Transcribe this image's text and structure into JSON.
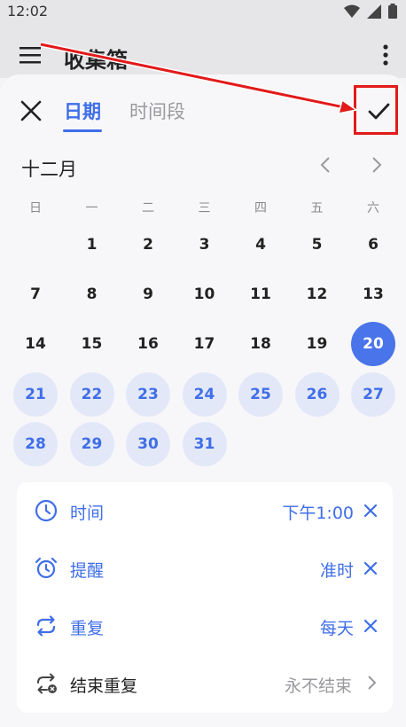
{
  "status": {
    "time": "12:02"
  },
  "appbar": {
    "title": "收集箱"
  },
  "tabs": [
    {
      "label": "日期",
      "active": true
    },
    {
      "label": "时间段",
      "active": false
    }
  ],
  "calendar": {
    "month": "十二月",
    "weekdays": [
      "日",
      "一",
      "二",
      "三",
      "四",
      "五",
      "六"
    ],
    "days": [
      "1",
      "2",
      "3",
      "4",
      "5",
      "6",
      "7",
      "8",
      "9",
      "10",
      "11",
      "12",
      "13",
      "14",
      "15",
      "16",
      "17",
      "18",
      "19",
      "20",
      "21",
      "22",
      "23",
      "24",
      "25",
      "26",
      "27",
      "28",
      "29",
      "30",
      "31"
    ],
    "selected_day": 20,
    "range_start": 21,
    "range_end": 31
  },
  "options": [
    {
      "label": "时间",
      "value": "下午1:00",
      "icon": "clock-icon"
    },
    {
      "label": "提醒",
      "value": "准时",
      "icon": "alarm-icon"
    },
    {
      "label": "重复",
      "value": "每天",
      "icon": "repeat-icon"
    },
    {
      "label": "结束重复",
      "value": "永不结束",
      "icon": "repeat-end-icon"
    }
  ],
  "colors": {
    "accent": "#3f6ee8",
    "selected": "#4a74ea",
    "range": "#e3e8f8",
    "highlight": "#e21a1a"
  }
}
